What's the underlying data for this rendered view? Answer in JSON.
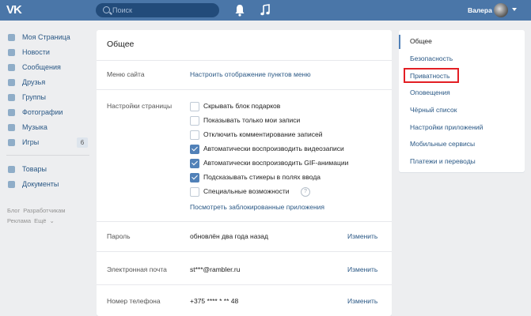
{
  "header": {
    "logo": "VK",
    "search_placeholder": "Поиск",
    "user_name": "Валера"
  },
  "leftnav": {
    "items": [
      {
        "label": "Моя Страница",
        "icon": "home-icon"
      },
      {
        "label": "Новости",
        "icon": "news-icon"
      },
      {
        "label": "Сообщения",
        "icon": "messages-icon"
      },
      {
        "label": "Друзья",
        "icon": "friends-icon"
      },
      {
        "label": "Группы",
        "icon": "groups-icon"
      },
      {
        "label": "Фотографии",
        "icon": "photos-icon"
      },
      {
        "label": "Музыка",
        "icon": "music-icon"
      },
      {
        "label": "Игры",
        "icon": "games-icon",
        "count": "6"
      }
    ],
    "items2": [
      {
        "label": "Товары",
        "icon": "goods-icon"
      },
      {
        "label": "Документы",
        "icon": "docs-icon"
      }
    ],
    "footer": [
      "Блог",
      "Разработчикам",
      "Реклама",
      "Ещё"
    ]
  },
  "main": {
    "title": "Общее",
    "site_menu_label": "Меню сайта",
    "site_menu_link": "Настроить отображение пунктов меню",
    "page_settings_label": "Настройки страницы",
    "checkboxes": [
      {
        "label": "Скрывать блок подарков",
        "checked": false
      },
      {
        "label": "Показывать только мои записи",
        "checked": false
      },
      {
        "label": "Отключить комментирование записей",
        "checked": false
      },
      {
        "label": "Автоматически воспроизводить видеозаписи",
        "checked": true
      },
      {
        "label": "Автоматически воспроизводить GIF-анимации",
        "checked": true
      },
      {
        "label": "Подсказывать стикеры в полях ввода",
        "checked": true
      },
      {
        "label": "Специальные возможности",
        "checked": false
      }
    ],
    "help_mark": "?",
    "blocked_apps_link": "Посмотреть заблокированные приложения",
    "password_label": "Пароль",
    "password_value": "обновлён два года назад",
    "email_label": "Электронная почта",
    "email_value": "st***@rambler.ru",
    "phone_label": "Номер телефона",
    "phone_value": "+375 **** * ** 48",
    "change_label": "Изменить"
  },
  "rightmenu": {
    "items": [
      "Общее",
      "Безопасность",
      "Приватность",
      "Оповещения",
      "Чёрный список",
      "Настройки приложений",
      "Мобильные сервисы",
      "Платежи и переводы"
    ],
    "active_index": 0,
    "highlighted_index": 2,
    "highlight_color": "#e31e24"
  }
}
